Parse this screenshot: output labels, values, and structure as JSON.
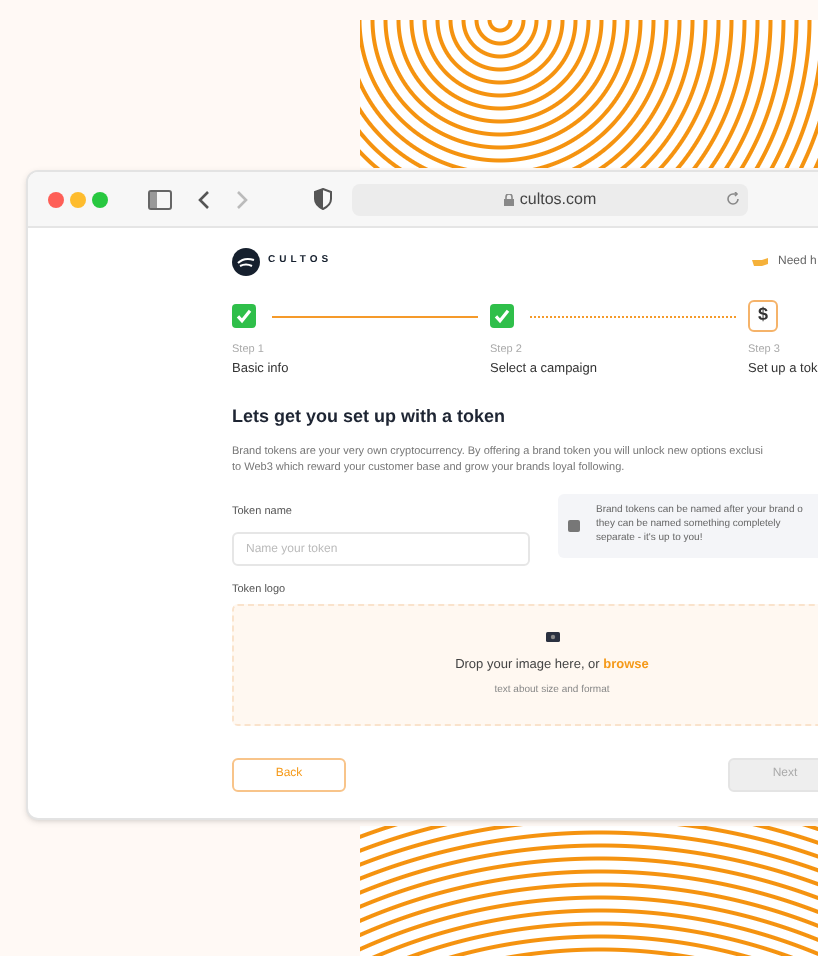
{
  "browser": {
    "url": "cultos.com"
  },
  "header": {
    "brand": "CULTOS",
    "help_link": "Need h"
  },
  "steps": [
    {
      "label": "Step 1",
      "title": "Basic info",
      "completed": true
    },
    {
      "label": "Step 2",
      "title": "Select a campaign",
      "completed": true
    },
    {
      "label": "Step 3",
      "title": "Set up a tok",
      "completed": false,
      "icon": "$"
    }
  ],
  "heading": "Lets get you set up with a token",
  "description": [
    "Brand tokens are your very own cryptocurrency. By offering a brand token you will unlock new options exclusi",
    "to Web3 which reward your customer base and grow your brands loyal following."
  ],
  "token_name": {
    "label": "Token name",
    "placeholder": "Name your token"
  },
  "info": [
    "Brand tokens can be named after your brand o",
    "they can be named something completely",
    "separate - it's up to you!"
  ],
  "token_logo": {
    "label": "Token logo",
    "drop_text": "Drop your image here, or ",
    "browse_link": "browse",
    "hint": "text about size and format"
  },
  "buttons": [
    {
      "label": "Back",
      "kind": "secondary",
      "disabled": false
    },
    {
      "label": "Next",
      "kind": "primary",
      "disabled": true
    }
  ]
}
